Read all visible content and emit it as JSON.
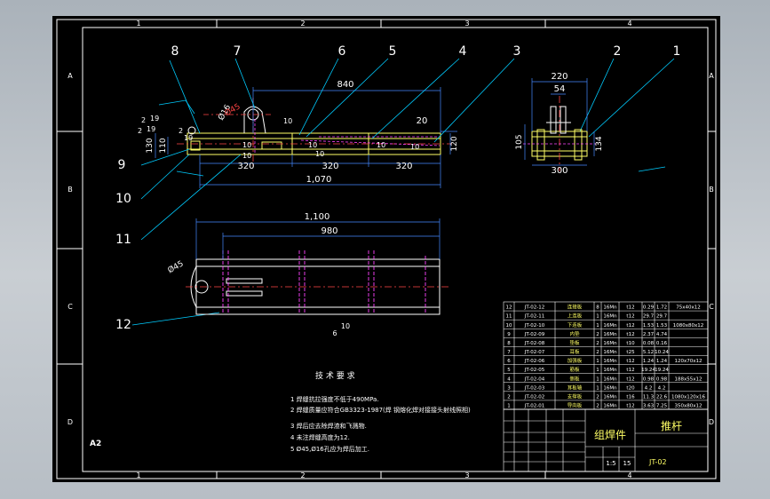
{
  "border": {
    "columns_top": [
      "1",
      "2",
      "3",
      "4"
    ],
    "columns_bottom": [
      "1",
      "2",
      "3",
      "4"
    ],
    "rows_left": [
      "A",
      "B",
      "C",
      "D"
    ],
    "rows_right": [
      "A",
      "B",
      "C",
      "D"
    ],
    "sheet_size": "A2"
  },
  "callouts": [
    "8",
    "7",
    "6",
    "5",
    "4",
    "3",
    "2",
    "1",
    "9",
    "10",
    "11",
    "12"
  ],
  "front_view": {
    "dims": {
      "top": "840",
      "bottom_total": "1,070",
      "seg1": "320",
      "seg2": "320",
      "seg3": "320",
      "right_small": "20",
      "right_height": "120",
      "left_height_outer": "130",
      "left_height_inner": "110",
      "hole": "Ø16",
      "pin": "Ø45"
    },
    "weld_marks": [
      "10",
      "10",
      "10",
      "10",
      "10",
      "10",
      "10"
    ],
    "small_nums": [
      "2",
      "19",
      "2",
      "19",
      "2",
      "19"
    ]
  },
  "side_view": {
    "dims": {
      "top": "220",
      "inner": "54",
      "bottom": "300",
      "left": "105",
      "right": "134"
    }
  },
  "plan_view": {
    "dims": {
      "outer": "1,100",
      "inner": "980",
      "end_dia": "Ø45",
      "weld_label": "10",
      "weld_num": "6"
    }
  },
  "tech_notes": {
    "title": "技 术 要 求",
    "items": [
      "1 焊缝抗拉强度不低于490MPa.",
      "2 焊缝质量应符合GB3323-1987(焊 钢熔化焊对接接头射线照相)",
      "3 焊后应去除焊渣和飞溅物.",
      "4 未注焊缝高度为12.",
      "5 Ø45,Ø16孔应为焊后加工."
    ]
  },
  "bom": {
    "rows": [
      {
        "no": "12",
        "code": "JT-02-12",
        "name": "连接板",
        "qty": "8",
        "mat": "16Mn",
        "spec": "t12",
        "w1": "0.29",
        "w2": "1.72",
        "size": "75x40x12"
      },
      {
        "no": "11",
        "code": "JT-02-11",
        "name": "上连板",
        "qty": "1",
        "mat": "16Mn",
        "spec": "t12",
        "w1": "29.7",
        "w2": "29.7",
        "size": ""
      },
      {
        "no": "10",
        "code": "JT-02-10",
        "name": "下连板",
        "qty": "1",
        "mat": "16Mn",
        "spec": "t12",
        "w1": "1.53",
        "w2": "1.53",
        "size": "1080x80x12"
      },
      {
        "no": "9",
        "code": "JT-02-09",
        "name": "内垫",
        "qty": "2",
        "mat": "16Mn",
        "spec": "t12",
        "w1": "2.37",
        "w2": "4.74",
        "size": ""
      },
      {
        "no": "8",
        "code": "JT-02-08",
        "name": "垫板",
        "qty": "2",
        "mat": "16Mn",
        "spec": "t10",
        "w1": "0.08",
        "w2": "0.16",
        "size": ""
      },
      {
        "no": "7",
        "code": "JT-02-07",
        "name": "耳板",
        "qty": "2",
        "mat": "16Mn",
        "spec": "t25",
        "w1": "5.12",
        "w2": "10.24",
        "size": ""
      },
      {
        "no": "6",
        "code": "JT-02-06",
        "name": "加强板",
        "qty": "1",
        "mat": "16Mn",
        "spec": "t12",
        "w1": "1.24",
        "w2": "1.24",
        "size": "120x70x12"
      },
      {
        "no": "5",
        "code": "JT-02-05",
        "name": "筋板",
        "qty": "1",
        "mat": "16Mn",
        "spec": "t12",
        "w1": "19.24",
        "w2": "19.24",
        "size": ""
      },
      {
        "no": "4",
        "code": "JT-02-04",
        "name": "侧板",
        "qty": "1",
        "mat": "16Mn",
        "spec": "t12",
        "w1": "0.98",
        "w2": "0.98",
        "size": "188x55x12"
      },
      {
        "no": "3",
        "code": "JT-02-03",
        "name": "耳板轴",
        "qty": "1",
        "mat": "16Mn",
        "spec": "t20",
        "w1": "4.2",
        "w2": "4.2",
        "size": ""
      },
      {
        "no": "2",
        "code": "JT-02-02",
        "name": "支撑板",
        "qty": "2",
        "mat": "16Mn",
        "spec": "t16",
        "w1": "11.3",
        "w2": "22.6",
        "size": "1080x120x16"
      },
      {
        "no": "1",
        "code": "JT-02-01",
        "name": "导向板",
        "qty": "2",
        "mat": "16Mn",
        "spec": "t12",
        "w1": "3.63",
        "w2": "7.25",
        "size": "350x80x12"
      }
    ]
  },
  "title_block": {
    "assembly_label": "组焊件",
    "part_name": "推杆",
    "drawing_no": "JT-02",
    "scale": "1:5",
    "sheet_info": "15"
  }
}
